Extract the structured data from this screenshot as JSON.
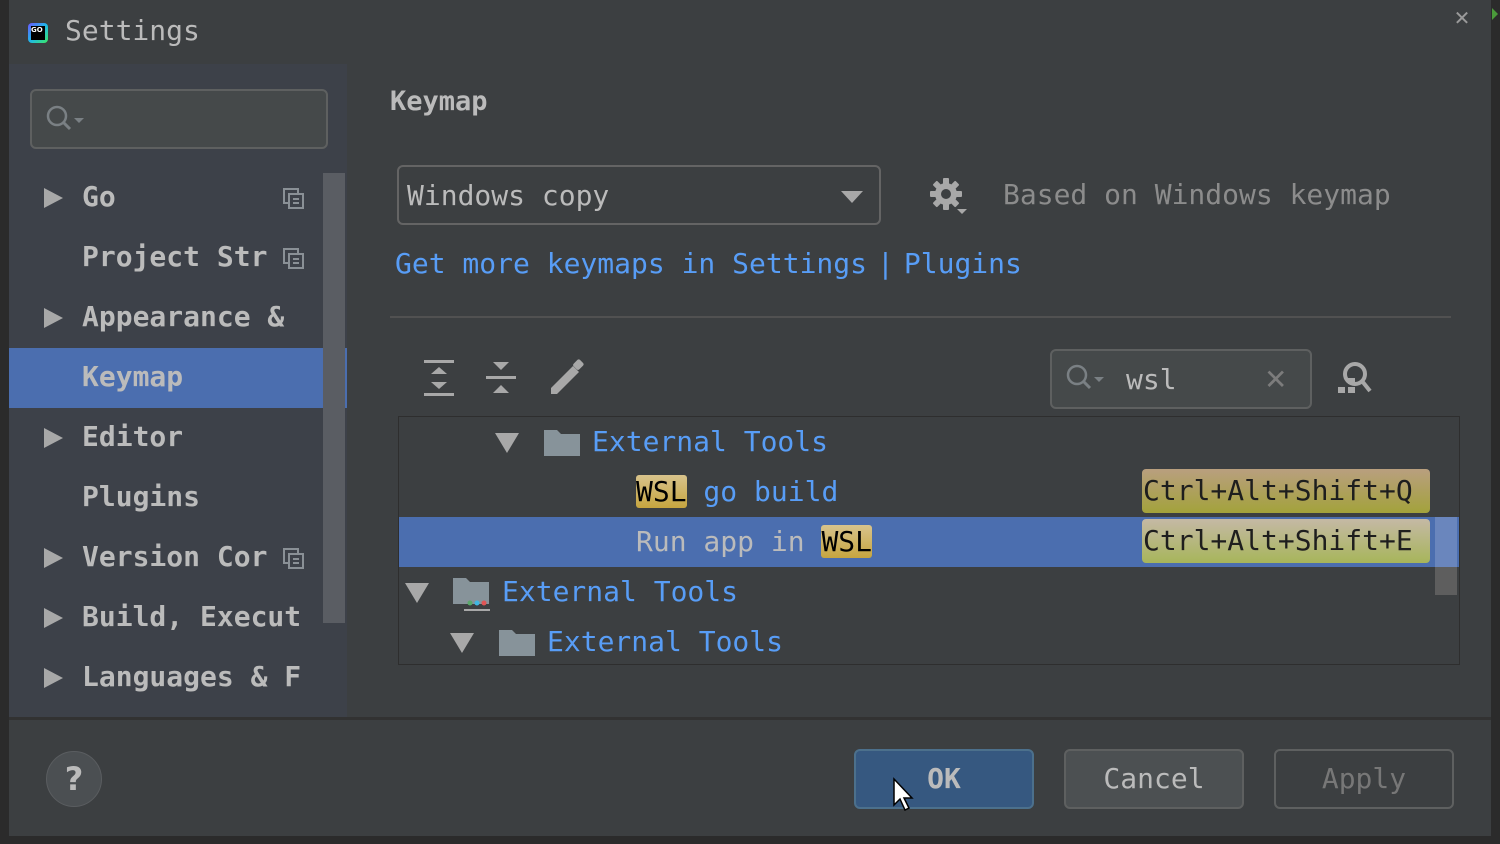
{
  "window": {
    "title": "Settings",
    "app_icon": "goland-icon",
    "close_icon": "close-icon",
    "close_glyph": "✕"
  },
  "sidebar": {
    "search": {
      "value": "",
      "placeholder": ""
    },
    "items": [
      {
        "label": "Go",
        "expandable": true,
        "project_icon": true,
        "selected": false
      },
      {
        "label": "Project Str",
        "expandable": false,
        "project_icon": true,
        "selected": false
      },
      {
        "label": "Appearance &",
        "expandable": true,
        "project_icon": false,
        "selected": false
      },
      {
        "label": "Keymap",
        "expandable": false,
        "project_icon": false,
        "selected": true
      },
      {
        "label": "Editor",
        "expandable": true,
        "project_icon": false,
        "selected": false
      },
      {
        "label": "Plugins",
        "expandable": false,
        "project_icon": false,
        "selected": false
      },
      {
        "label": "Version Cor",
        "expandable": true,
        "project_icon": true,
        "selected": false
      },
      {
        "label": "Build, Execut",
        "expandable": true,
        "project_icon": false,
        "selected": false
      },
      {
        "label": "Languages & F",
        "expandable": true,
        "project_icon": false,
        "selected": false
      }
    ]
  },
  "keymap": {
    "heading": "Keymap",
    "selected_keymap": "Windows copy",
    "based_on": "Based on Windows keymap",
    "link_left": "Get more keymaps in Settings",
    "link_sep": "|",
    "link_right": "Plugins",
    "toolbar": {
      "expand_all": "expand-all-icon",
      "collapse_all": "collapse-all-icon",
      "edit": "edit-icon"
    },
    "filter": {
      "value": "wsl",
      "clear_glyph": "✕"
    },
    "tree": [
      {
        "type": "folder",
        "label": "External Tools",
        "expanded": true
      },
      {
        "type": "action",
        "highlight": "WSL",
        "rest": " go build",
        "shortcut": "Ctrl+Alt+Shift+Q",
        "selected": false
      },
      {
        "type": "action",
        "prefix": "Run app in ",
        "highlight": "WSL",
        "shortcut": "Ctrl+Alt+Shift+E",
        "selected": true
      },
      {
        "type": "tools-root",
        "label": "External Tools",
        "expanded": true
      },
      {
        "type": "folder",
        "label": "External Tools",
        "expanded": true
      }
    ]
  },
  "footer": {
    "help": "?",
    "ok": "OK",
    "cancel": "Cancel",
    "apply": "Apply"
  },
  "colors": {
    "accent_selection": "#4b6eaf",
    "link": "#589df6",
    "highlight": "#c6a53f",
    "ok_button": "#365880"
  }
}
